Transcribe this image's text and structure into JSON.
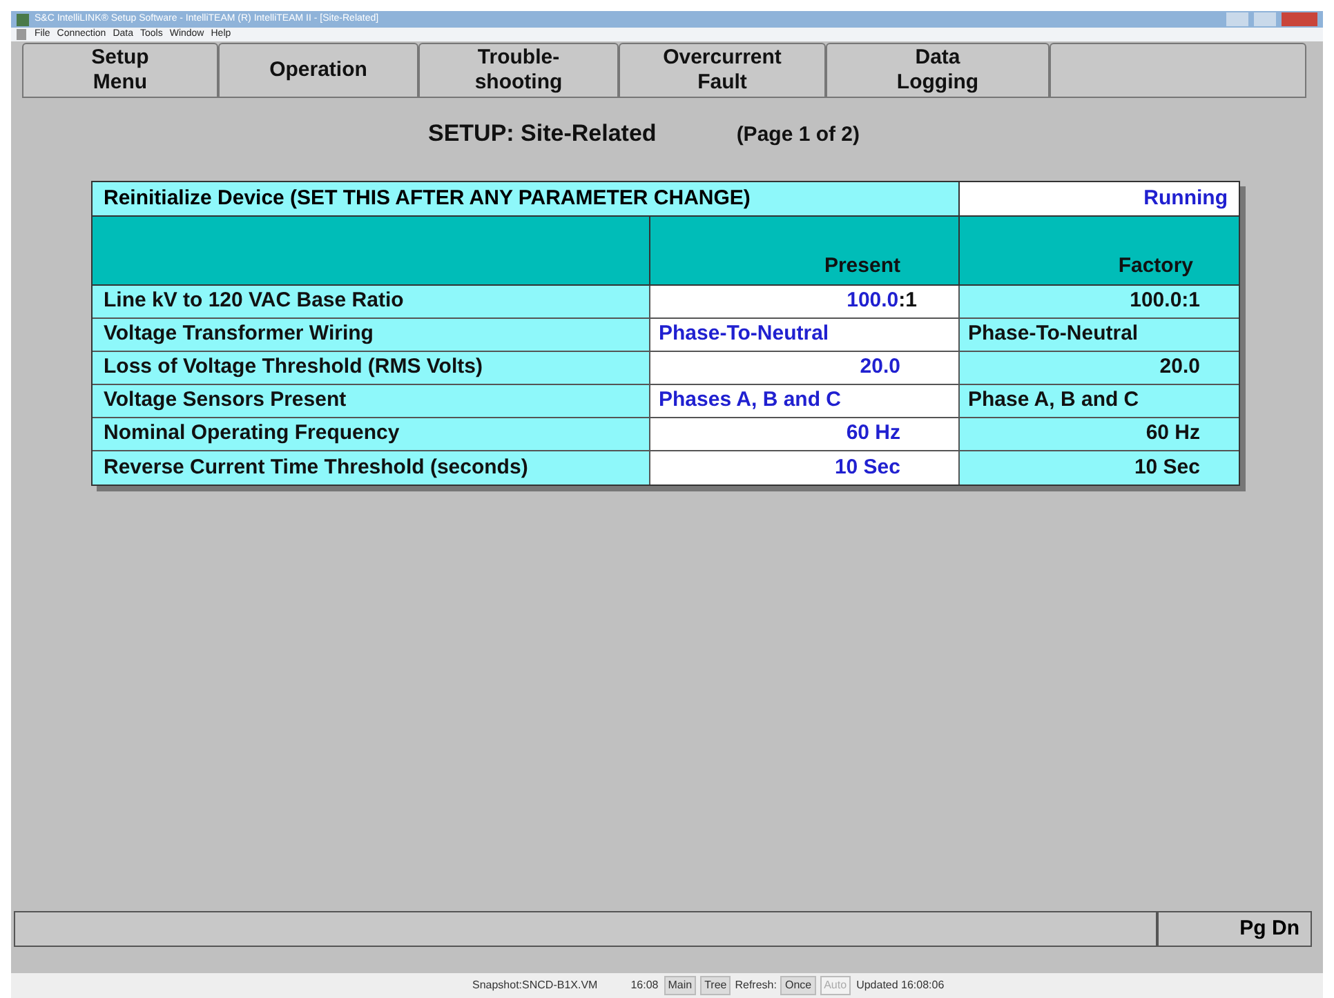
{
  "window": {
    "title": "S&C IntelliLINK® Setup Software - IntelliTEAM (R) IntelliTEAM II - [Site-Related]"
  },
  "menu": [
    "File",
    "Connection",
    "Data",
    "Tools",
    "Window",
    "Help"
  ],
  "nav_buttons": [
    {
      "line1": "Setup",
      "line2": "Menu"
    },
    {
      "line1": "Operation"
    },
    {
      "line1": "Trouble-",
      "line2": "shooting"
    },
    {
      "line1": "Overcurrent",
      "line2": "Fault"
    },
    {
      "line1": "Data",
      "line2": "Logging"
    }
  ],
  "heading": "SETUP: Site-Related",
  "page": "(Page 1 of 2)",
  "reinit": {
    "label": "Reinitialize Device (SET THIS AFTER ANY PARAMETER CHANGE)",
    "status": "Running"
  },
  "table": {
    "columns": [
      "Present",
      "Factory"
    ],
    "rows": [
      {
        "label": "Line kV to 120 VAC Base Ratio",
        "kind": "number",
        "present": "100.0",
        "present_suffix": ":1",
        "factory": "100.0:1"
      },
      {
        "label": "Voltage Transformer Wiring",
        "kind": "text",
        "present": "Phase-To-Neutral",
        "factory": "Phase-To-Neutral"
      },
      {
        "label": "Loss of Voltage Threshold (RMS Volts)",
        "kind": "number",
        "present": "20.0",
        "factory": "20.0"
      },
      {
        "label": "Voltage Sensors Present",
        "kind": "text",
        "present": "Phases A, B and C",
        "factory": "Phase A, B and C"
      },
      {
        "label": "Nominal Operating Frequency",
        "kind": "number",
        "present": "60 Hz",
        "factory": "60 Hz"
      },
      {
        "label": "Reverse Current Time Threshold (seconds)",
        "kind": "number",
        "present": "10 Sec",
        "factory": "10 Sec"
      }
    ]
  },
  "pg_dn": "Pg Dn",
  "status_bar": {
    "snapshot": "Snapshot:SNCD-B1X.VM",
    "time": "16:08",
    "buttons": [
      {
        "label": "Main",
        "disabled": false
      },
      {
        "label": "Tree",
        "disabled": false
      }
    ],
    "refresh_label": "Refresh:",
    "refresh": [
      {
        "label": "Once",
        "disabled": false
      },
      {
        "label": "Auto",
        "disabled": true
      }
    ],
    "updated": "Updated 16:08:06"
  }
}
